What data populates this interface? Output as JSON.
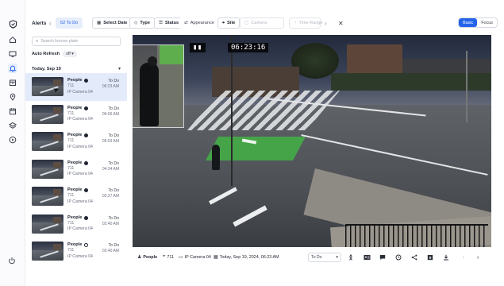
{
  "toolbar": {
    "title": "Alerts",
    "prev": "‹",
    "next": "›",
    "filter_todo": "52 To Do",
    "select_date": "Select Date",
    "type": "Type",
    "status": "Status",
    "appearance": "Appearance",
    "site": "Site",
    "camera_placeholder": "Camera",
    "time_range_placeholder": "Time Range",
    "close": "✕",
    "view_modes": [
      "Basic",
      "Focus"
    ],
    "active_view": "Basic"
  },
  "sidebar_rail": {
    "icons": [
      "logo-shield-icon",
      "home-icon",
      "monitor-icon",
      "bell-icon",
      "archive-icon",
      "map-pin-icon",
      "calendar-icon",
      "layers-icon",
      "play-circle-icon",
      "power-icon"
    ],
    "active": "bell-icon"
  },
  "list": {
    "search_placeholder": "Search license plate",
    "auto_refresh_label": "Auto Refresh",
    "auto_refresh_value": "off",
    "day_label": "Today, Sep 19",
    "items": [
      {
        "type": "People",
        "location": "711",
        "camera": "IP Camera 04",
        "status": "To Do",
        "time": "06:23 AM",
        "selected": true
      },
      {
        "type": "People",
        "location": "711",
        "camera": "IP Camera 04",
        "status": "To Do",
        "time": "06:06 AM",
        "selected": false
      },
      {
        "type": "People",
        "location": "711",
        "camera": "IP Camera 04",
        "status": "To Do",
        "time": "05:03 AM",
        "selected": false
      },
      {
        "type": "People",
        "location": "711",
        "camera": "IP Camera 04",
        "status": "To Do",
        "time": "04:34 AM",
        "selected": false
      },
      {
        "type": "People",
        "location": "711",
        "camera": "IP Camera 04",
        "status": "To Do",
        "time": "03:37 AM",
        "selected": false
      },
      {
        "type": "People",
        "location": "711",
        "camera": "IP Camera 04",
        "status": "To Do",
        "time": "02:40 AM",
        "selected": false
      },
      {
        "type": "People",
        "location": "711",
        "camera": "IP Camera 04",
        "status": "To Do",
        "time": "02:40 AM",
        "selected": false
      }
    ]
  },
  "video": {
    "overlay_timestamp": "06:23:16"
  },
  "details": {
    "type": "People",
    "location": "711",
    "camera": "IP Camera 04",
    "datetime": "Today, Sep 19, 2024, 06:23 AM",
    "status_value": "To Do",
    "actions": [
      "person-pose-icon",
      "id-card-icon",
      "comment-icon",
      "history-icon",
      "share-icon",
      "archive-down-icon",
      "download-icon",
      "prev-icon",
      "next-icon"
    ]
  },
  "colors": {
    "accent": "#2563eb",
    "selected_row": "#e3ebfb"
  }
}
